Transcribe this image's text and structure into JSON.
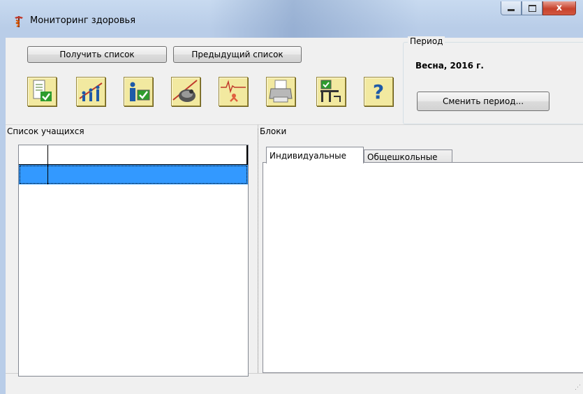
{
  "window": {
    "title": "Мониторинг здоровья",
    "controls": {
      "minimize_icon": "minimize-icon",
      "maximize_icon": "maximize-icon",
      "close_label": "x"
    }
  },
  "toolbar": {
    "get_list_label": "Получить список",
    "previous_list_label": "Предыдущий список",
    "icon_buttons": [
      "checklist-icon",
      "growth-chart-icon",
      "person-check-icon",
      "weight-scale-icon",
      "cardiogram-icon",
      "printer-icon",
      "desk-check-icon",
      "help-icon"
    ]
  },
  "period": {
    "caption": "Период",
    "value": "Весна, 2016 г.",
    "change_label": "Сменить период..."
  },
  "students": {
    "caption": "Список учащихся"
  },
  "blocks": {
    "caption": "Блоки",
    "tabs": [
      {
        "label": "Индивидуальные",
        "active": true
      },
      {
        "label": "Общешкольные",
        "active": false
      }
    ]
  },
  "colors": {
    "selection": "#3399ff",
    "icon_button_bg": "#f2e9a0",
    "close_button": "#c7422c"
  }
}
